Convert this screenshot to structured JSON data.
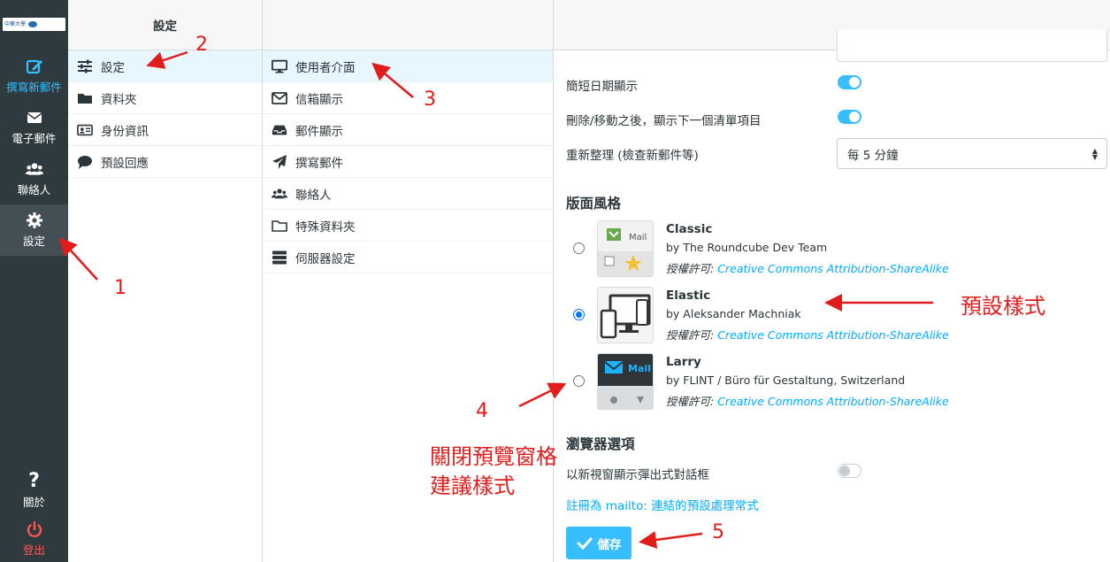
{
  "nav": {
    "logo_text": "中華大學",
    "compose": "撰寫新郵件",
    "mail": "電子郵件",
    "contacts": "聯絡人",
    "settings": "設定",
    "about": "關於",
    "logout": "登出"
  },
  "settings_col": {
    "title": "設定",
    "items": [
      {
        "label": "設定",
        "icon": "sliders-icon"
      },
      {
        "label": "資料夾",
        "icon": "folder-icon"
      },
      {
        "label": "身份資訊",
        "icon": "id-card-icon"
      },
      {
        "label": "預設回應",
        "icon": "comment-icon"
      }
    ]
  },
  "prefs_col": {
    "items": [
      {
        "label": "使用者介面",
        "icon": "monitor-icon"
      },
      {
        "label": "信箱顯示",
        "icon": "envelope-icon"
      },
      {
        "label": "郵件顯示",
        "icon": "inbox-icon"
      },
      {
        "label": "撰寫郵件",
        "icon": "paper-plane-icon"
      },
      {
        "label": "聯絡人",
        "icon": "users-icon"
      },
      {
        "label": "特殊資料夾",
        "icon": "folder-outline-icon"
      },
      {
        "label": "伺服器設定",
        "icon": "server-icon"
      }
    ]
  },
  "main": {
    "short_date_label": "簡短日期顯示",
    "short_date_on": true,
    "next_item_label": "刪除/移動之後，顯示下一個清單項目",
    "next_item_on": true,
    "refresh_label": "重新整理 (檢查新郵件等)",
    "refresh_value": "每 5 分鐘",
    "skin_section": "版面風格",
    "skins": [
      {
        "name": "Classic",
        "author": "by The Roundcube Dev Team",
        "license_prefix": "授權許可:",
        "license": "Creative Commons Attribution-ShareAlike",
        "checked": false,
        "thumb_label": "Mail"
      },
      {
        "name": "Elastic",
        "author": "by Aleksander Machniak",
        "license_prefix": "授權許可:",
        "license": "Creative Commons Attribution-ShareAlike",
        "checked": true,
        "thumb_label": ""
      },
      {
        "name": "Larry",
        "author": "by FLINT / Büro für Gestaltung, Switzerland",
        "license_prefix": "授權許可:",
        "license": "Creative Commons Attribution-ShareAlike",
        "checked": false,
        "thumb_label": "Mail"
      }
    ],
    "browser_section": "瀏覽器選項",
    "popup_label": "以新視窗顯示彈出式對話框",
    "popup_on": false,
    "mailto_link": "註冊為 mailto: 連結的預設處理常式",
    "save_label": "儲存"
  },
  "annotations": {
    "n1": "1",
    "n2": "2",
    "n3": "3",
    "n4": "4",
    "n5": "5",
    "default_style": "預設樣式",
    "note_line1": "關閉預覽窗格",
    "note_line2": "建議樣式"
  },
  "colors": {
    "nav_bg": "#2f3a3f",
    "accent": "#37beff",
    "link": "#00acff",
    "annotation": "#e21b1b",
    "logout": "#ff5552"
  }
}
